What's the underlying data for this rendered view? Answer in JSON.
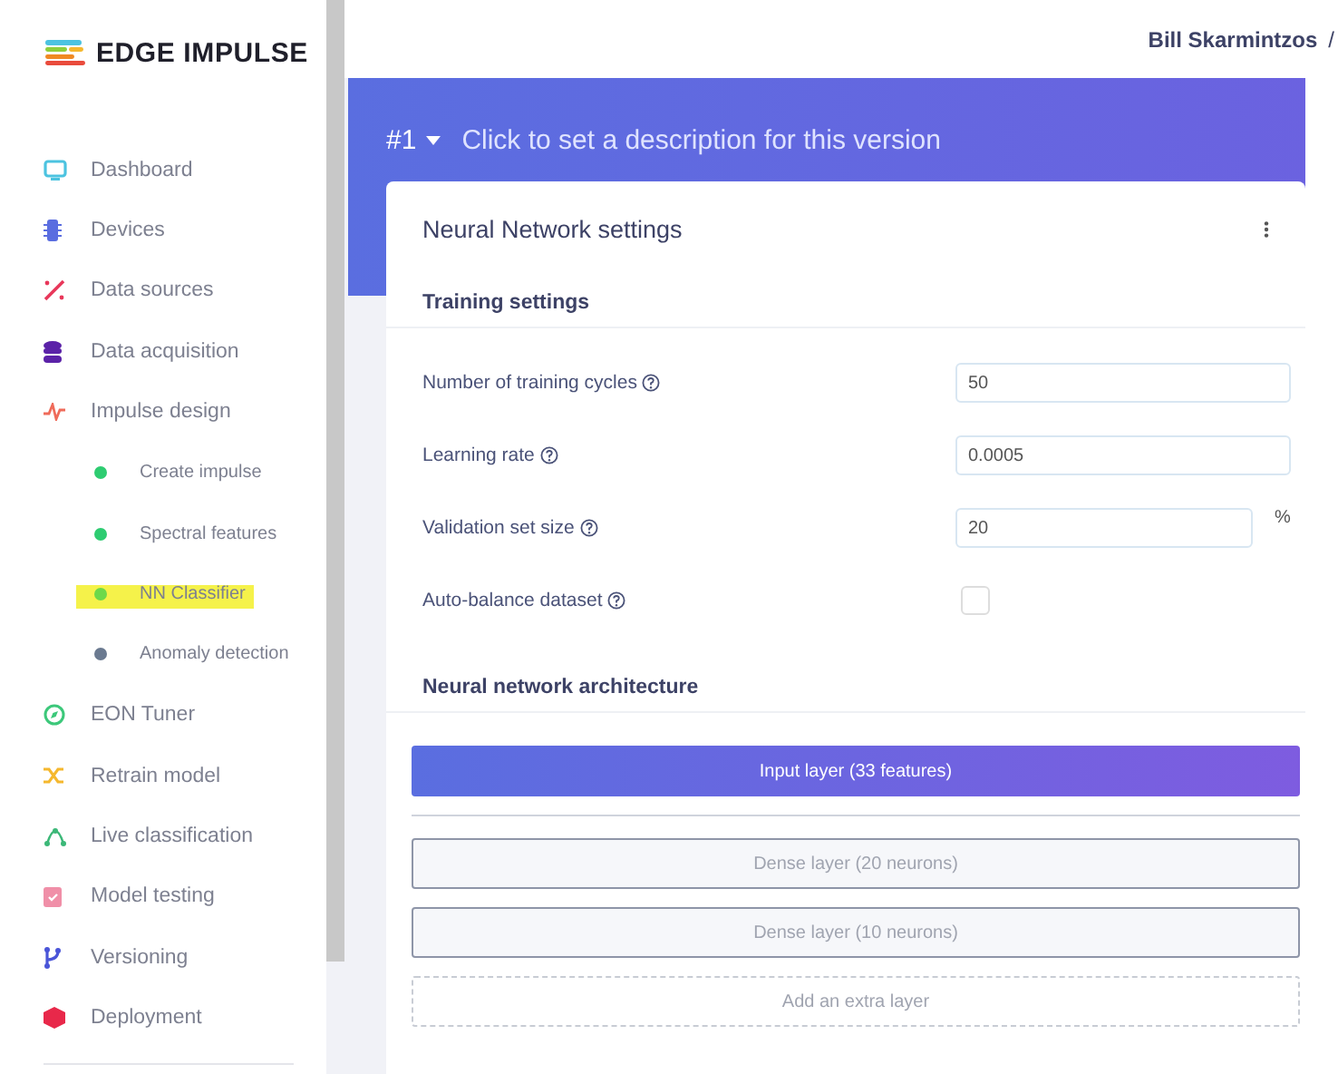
{
  "logo": {
    "text": "EDGE IMPULSE"
  },
  "sidebar": {
    "items": [
      {
        "label": "Dashboard"
      },
      {
        "label": "Devices"
      },
      {
        "label": "Data sources"
      },
      {
        "label": "Data acquisition"
      },
      {
        "label": "Impulse design",
        "children": [
          {
            "label": "Create impulse",
            "color": "#2ecc71",
            "highlighted": false
          },
          {
            "label": "Spectral features",
            "color": "#2ecc71",
            "highlighted": false
          },
          {
            "label": "NN Classifier",
            "color": "#6dd94a",
            "highlighted": true
          },
          {
            "label": "Anomaly detection",
            "color": "#6b7a90",
            "highlighted": false
          }
        ]
      },
      {
        "label": "EON Tuner"
      },
      {
        "label": "Retrain model"
      },
      {
        "label": "Live classification"
      },
      {
        "label": "Model testing"
      },
      {
        "label": "Versioning"
      },
      {
        "label": "Deployment"
      }
    ]
  },
  "header": {
    "user": "Bill Skarmintzos",
    "separator": "/"
  },
  "banner": {
    "version": "#1",
    "description": "Click to set a description for this version"
  },
  "card": {
    "title": "Neural Network settings",
    "training": {
      "title": "Training settings",
      "fields": [
        {
          "kind": "input",
          "label": "Number of training cycles",
          "value": "50"
        },
        {
          "kind": "input",
          "label": "Learning rate",
          "value": "0.0005"
        },
        {
          "kind": "input",
          "label": "Validation set size",
          "value": "20",
          "unit": "%"
        },
        {
          "kind": "checkbox",
          "label": "Auto-balance dataset",
          "checked": false
        }
      ]
    },
    "architecture": {
      "title": "Neural network architecture",
      "layers": [
        {
          "kind": "input",
          "label": "Input layer (33 features)"
        },
        {
          "kind": "dense",
          "label": "Dense layer (20 neurons)"
        },
        {
          "kind": "dense",
          "label": "Dense layer (10 neurons)"
        },
        {
          "kind": "add",
          "label": "Add an extra layer"
        }
      ]
    }
  }
}
